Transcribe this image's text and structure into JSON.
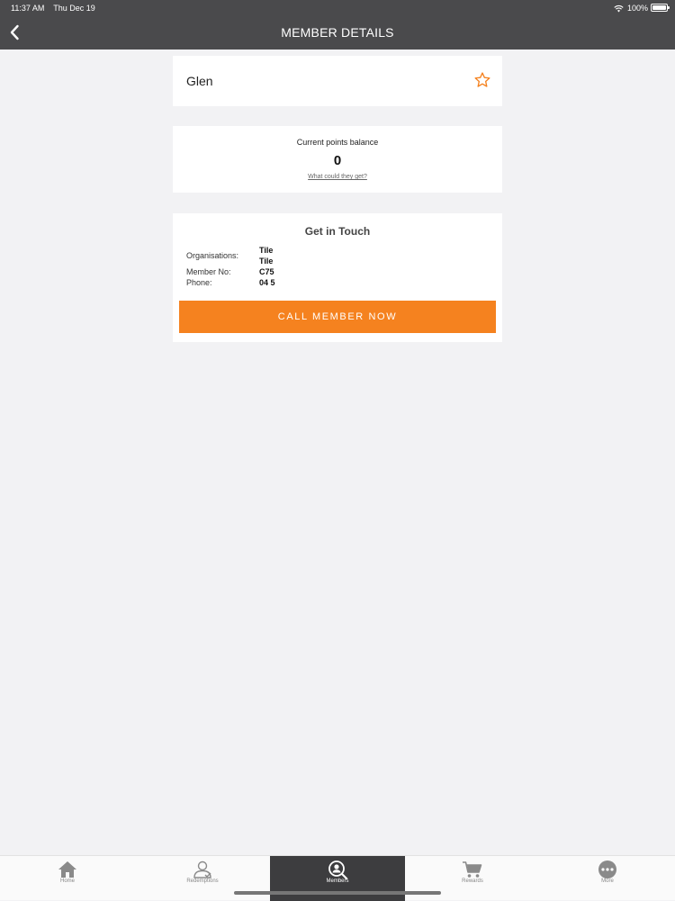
{
  "status_bar": {
    "time": "11:37 AM",
    "date": "Thu Dec 19",
    "battery": "100%"
  },
  "header": {
    "title": "MEMBER DETAILS"
  },
  "member": {
    "name": "Glen"
  },
  "points": {
    "label": "Current points balance",
    "value": "0",
    "link": "What could they get?"
  },
  "contact": {
    "title": "Get in Touch",
    "rows": [
      {
        "label": "Organisations:",
        "values": [
          "Tile",
          "Tile"
        ]
      },
      {
        "label": "Member No:",
        "value": "C75"
      },
      {
        "label": "Phone:",
        "value": "04 5"
      }
    ],
    "call_label": "CALL MEMBER NOW"
  },
  "tabs": [
    {
      "label": "Home",
      "icon": "home-icon"
    },
    {
      "label": "Redemptions",
      "icon": "user-icon"
    },
    {
      "label": "Members",
      "icon": "member-search-icon",
      "active": true
    },
    {
      "label": "Rewards",
      "icon": "cart-icon"
    },
    {
      "label": "More",
      "icon": "more-icon"
    }
  ],
  "colors": {
    "accent": "#f5821f",
    "header": "#4a4a4c",
    "active_tab": "#3d3d3f"
  }
}
